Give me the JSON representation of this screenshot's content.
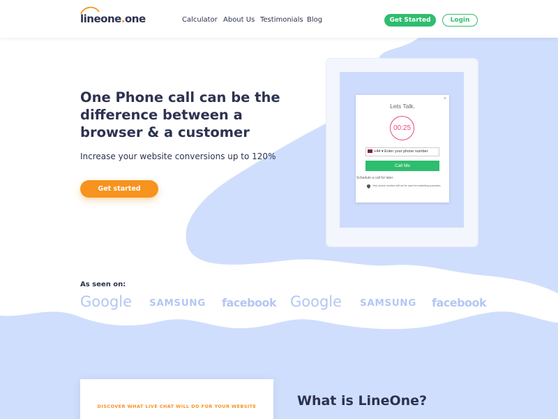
{
  "header": {
    "logo_text_1": "lineone",
    "logo_dot": ".",
    "logo_text_2": "one",
    "nav": [
      "Calculator",
      "About Us",
      "Testimonials",
      "Blog"
    ],
    "get_started_label": "Get Started",
    "login_label": "Login"
  },
  "hero": {
    "title": "One Phone call can be the difference between a browser & a customer",
    "subtitle": "Increase your website conversions up to 120%",
    "cta_label": "Get started"
  },
  "widget": {
    "close": "×",
    "title": "Lets Talk.",
    "timer": "00:25",
    "country_code": "+44",
    "phone_placeholder": "Enter your phone number",
    "call_label": "Call Me",
    "schedule_text": "Schedule a call for later",
    "privacy_text": "Your phone number will not be used for marketing purposes"
  },
  "seen_on": {
    "label": "As seen on:",
    "brands": [
      "Google",
      "SAMSUNG",
      "facebook",
      "Google",
      "SAMSUNG",
      "facebook"
    ]
  },
  "bottom": {
    "card_text": "DISCOVER WHAT LIVE CHAT WILL DO FOR YOUR WEBSITE",
    "section_title": "What is LineOne?"
  },
  "colors": {
    "brand_green": "#2ebd6e",
    "brand_orange": "#f7931e",
    "blob_blue": "#d0defd",
    "text_dark": "#2d3250",
    "timer_pink": "#e8467c"
  }
}
